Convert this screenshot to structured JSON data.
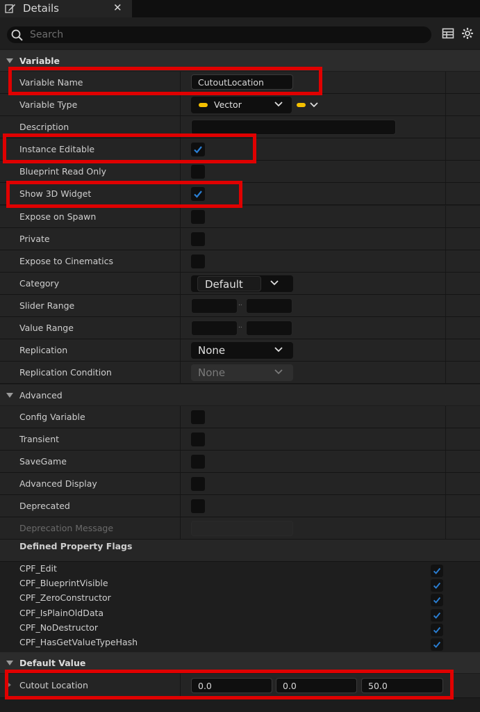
{
  "tab": {
    "title": "Details",
    "close": "✕"
  },
  "search": {
    "placeholder": "Search"
  },
  "variable_section": {
    "title": "Variable"
  },
  "rows": {
    "variable_name": {
      "label": "Variable Name",
      "value": "CutoutLocation"
    },
    "variable_type": {
      "label": "Variable Type",
      "value": "Vector"
    },
    "description": {
      "label": "Description",
      "value": ""
    },
    "instance_editable": {
      "label": "Instance Editable",
      "checked": true
    },
    "blueprint_read_only": {
      "label": "Blueprint Read Only",
      "checked": false
    },
    "show_3d_widget": {
      "label": "Show 3D Widget",
      "checked": true
    },
    "expose_on_spawn": {
      "label": "Expose on Spawn",
      "checked": false
    },
    "private": {
      "label": "Private",
      "checked": false
    },
    "expose_to_cinematics": {
      "label": "Expose to Cinematics",
      "checked": false
    },
    "category": {
      "label": "Category",
      "value": "Default"
    },
    "slider_range": {
      "label": "Slider Range",
      "separator": ".."
    },
    "value_range": {
      "label": "Value Range",
      "separator": ".."
    },
    "replication": {
      "label": "Replication",
      "value": "None"
    },
    "replication_condition": {
      "label": "Replication Condition",
      "value": "None"
    }
  },
  "advanced_section": {
    "title": "Advanced"
  },
  "advanced_rows": {
    "config_variable": {
      "label": "Config Variable",
      "checked": false
    },
    "transient": {
      "label": "Transient",
      "checked": false
    },
    "savegame": {
      "label": "SaveGame",
      "checked": false
    },
    "advanced_display": {
      "label": "Advanced Display",
      "checked": false
    },
    "deprecated": {
      "label": "Deprecated",
      "checked": false
    },
    "deprecation_message": {
      "label": "Deprecation Message",
      "value": ""
    }
  },
  "defined_flags": {
    "title": "Defined Property Flags",
    "items": [
      "CPF_Edit",
      "CPF_BlueprintVisible",
      "CPF_ZeroConstructor",
      "CPF_IsPlainOldData",
      "CPF_NoDestructor",
      "CPF_HasGetValueTypeHash"
    ]
  },
  "default_value_section": {
    "title": "Default Value"
  },
  "cutout_location": {
    "label": "Cutout Location",
    "x": "0.0",
    "y": "0.0",
    "z": "50.0"
  },
  "colors": {
    "accent_check": "#2a7fd4",
    "vector_pin": "#f5c000",
    "highlight_box": "#e00000"
  }
}
